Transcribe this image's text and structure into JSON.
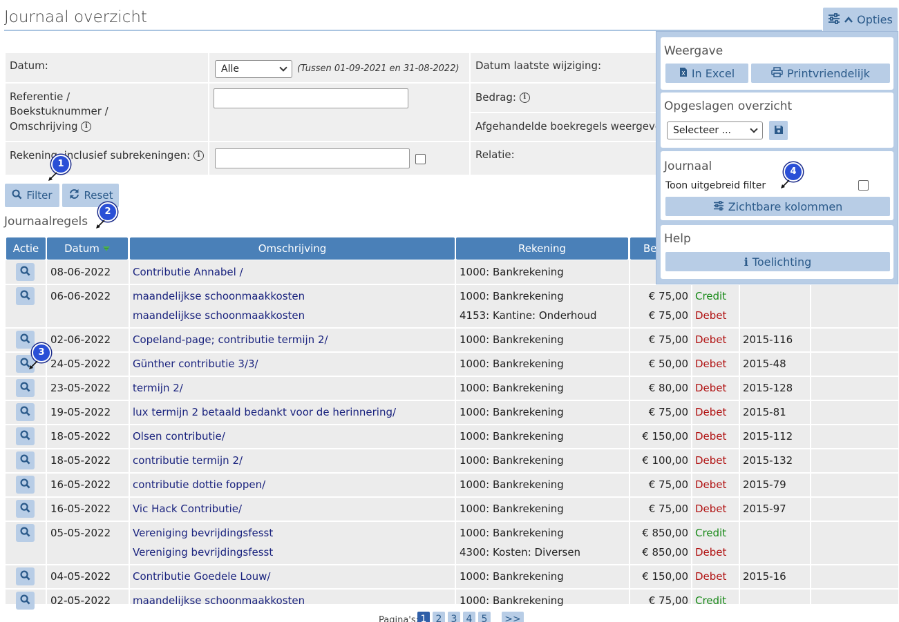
{
  "header": {
    "title": "Journaal overzicht",
    "opties_label": "Opties"
  },
  "filters": {
    "datum_label": "Datum:",
    "datum_select": "Alle",
    "datum_range": "(Tussen 01-09-2021 en 31-08-2022)",
    "referentie_label_1": "Referentie /",
    "referentie_label_2": "Boekstuknummer /",
    "referentie_label_3": "Omschrijving",
    "rekening_label": "Rekening, inclusief subrekeningen:",
    "datum_wijziging_label": "Datum laatste wijziging:",
    "bedrag_label": "Bedrag:",
    "afgehandeld_label": "Afgehandelde boekregels weergeven:",
    "relatie_label": "Relatie:",
    "filter_button": "Filter",
    "reset_button": "Reset"
  },
  "section": {
    "title": "Journaalregels"
  },
  "table": {
    "headers": [
      "Actie",
      "Datum",
      "Omschrijving",
      "Rekening",
      "Be"
    ],
    "rows": [
      {
        "date": "08-06-2022",
        "lines": [
          {
            "desc": "Contributie Annabel /",
            "account": "1000: Bankrekening",
            "amount": "€",
            "type": "",
            "ref": ""
          }
        ]
      },
      {
        "date": "06-06-2022",
        "lines": [
          {
            "desc": "maandelijkse schoonmaakkosten",
            "account": "1000: Bankrekening",
            "amount": "€ 75,00",
            "type": "Credit",
            "ref": ""
          },
          {
            "desc": "maandelijkse schoonmaakkosten",
            "account": "4153: Kantine: Onderhoud",
            "amount": "€ 75,00",
            "type": "Debet",
            "ref": ""
          }
        ]
      },
      {
        "date": "02-06-2022",
        "lines": [
          {
            "desc": "Copeland-page; contributie termijn 2/",
            "account": "1000: Bankrekening",
            "amount": "€ 75,00",
            "type": "Debet",
            "ref": "2015-116"
          }
        ]
      },
      {
        "date": "24-05-2022",
        "lines": [
          {
            "desc": "Günther contributie 3/3/",
            "account": "1000: Bankrekening",
            "amount": "€ 50,00",
            "type": "Debet",
            "ref": "2015-48"
          }
        ]
      },
      {
        "date": "23-05-2022",
        "lines": [
          {
            "desc": "termijn 2/",
            "account": "1000: Bankrekening",
            "amount": "€ 80,00",
            "type": "Debet",
            "ref": "2015-128"
          }
        ]
      },
      {
        "date": "19-05-2022",
        "lines": [
          {
            "desc": "lux termijn 2 betaald bedankt voor de herinnering/",
            "account": "1000: Bankrekening",
            "amount": "€ 75,00",
            "type": "Debet",
            "ref": "2015-81"
          }
        ]
      },
      {
        "date": "18-05-2022",
        "lines": [
          {
            "desc": "Olsen contributie/",
            "account": "1000: Bankrekening",
            "amount": "€ 150,00",
            "type": "Debet",
            "ref": "2015-112"
          }
        ]
      },
      {
        "date": "18-05-2022",
        "lines": [
          {
            "desc": "contributie termijn 2/",
            "account": "1000: Bankrekening",
            "amount": "€ 100,00",
            "type": "Debet",
            "ref": "2015-132"
          }
        ]
      },
      {
        "date": "16-05-2022",
        "lines": [
          {
            "desc": "contributie dottie foppen/",
            "account": "1000: Bankrekening",
            "amount": "€ 75,00",
            "type": "Debet",
            "ref": "2015-79"
          }
        ]
      },
      {
        "date": "16-05-2022",
        "lines": [
          {
            "desc": "Vic Hack Contributie/",
            "account": "1000: Bankrekening",
            "amount": "€ 75,00",
            "type": "Debet",
            "ref": "2015-97"
          }
        ]
      },
      {
        "date": "05-05-2022",
        "lines": [
          {
            "desc": "Vereniging bevrijdingsfesst",
            "account": "1000: Bankrekening",
            "amount": "€ 850,00",
            "type": "Credit",
            "ref": ""
          },
          {
            "desc": "Vereniging bevrijdingsfesst",
            "account": "4300: Kosten: Diversen",
            "amount": "€ 850,00",
            "type": "Debet",
            "ref": ""
          }
        ]
      },
      {
        "date": "04-05-2022",
        "lines": [
          {
            "desc": "Contributie Goedele Louw/",
            "account": "1000: Bankrekening",
            "amount": "€ 150,00",
            "type": "Debet",
            "ref": "2015-16"
          }
        ]
      },
      {
        "date": "02-05-2022",
        "lines": [
          {
            "desc": "maandelijkse schoonmaakkosten",
            "account": "1000: Bankrekening",
            "amount": "€ 75,00",
            "type": "Credit",
            "ref": ""
          }
        ]
      }
    ]
  },
  "pagination": {
    "label": "Pagina's:",
    "pages": [
      "1",
      "2",
      "3",
      "4",
      "5"
    ],
    "next": ">>"
  },
  "options_panel": {
    "weergave_title": "Weergave",
    "excel_button": "In Excel",
    "print_button": "Printvriendelijk",
    "opgeslagen_title": "Opgeslagen overzicht",
    "opgeslagen_select": "Selecteer ...",
    "journaal_title": "Journaal",
    "uitgebreid_label": "Toon uitgebreid filter",
    "kolommen_button": "Zichtbare kolommen",
    "help_title": "Help",
    "toelichting_button": "Toelichting"
  },
  "markers": [
    "1",
    "2",
    "3",
    "4"
  ],
  "colors": {
    "accent": "#4a80b8",
    "button_light": "#b8cde6",
    "credit": "#1a8a1a",
    "debet": "#b01010",
    "marker": "#2a4fd6"
  }
}
